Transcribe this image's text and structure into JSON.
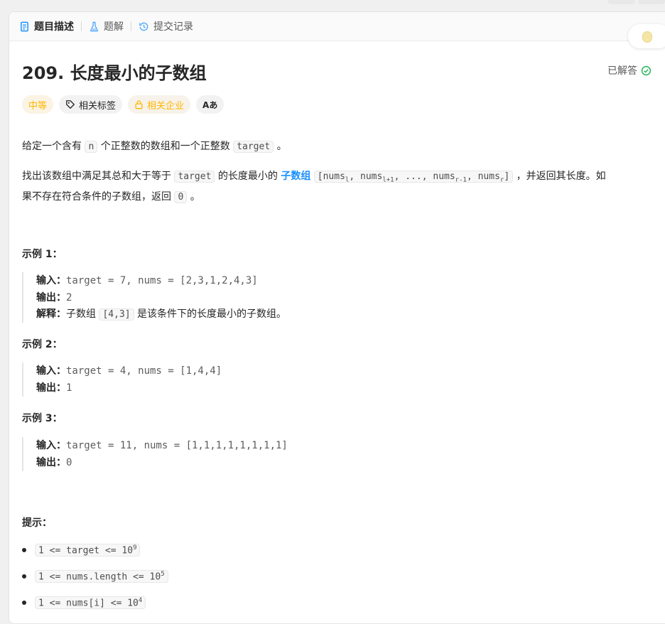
{
  "tabs": [
    {
      "label": "题目描述",
      "icon": "document-icon"
    },
    {
      "label": "题解",
      "icon": "flask-icon"
    },
    {
      "label": "提交记录",
      "icon": "history-icon"
    }
  ],
  "problem": {
    "title": "209. 长度最小的子数组",
    "status": "已解答",
    "tags": {
      "difficulty": "中等",
      "related_tags": "相关标签",
      "companies": "相关企业",
      "translate": "Aあ"
    }
  },
  "description": {
    "p1": {
      "a": "给定一个含有 ",
      "code1": "n",
      "b": " 个正整数的数组和一个正整数 ",
      "code2": "target",
      "c": " 。"
    },
    "p2": {
      "a": "找出该数组中满足其总和大于等于 ",
      "code1": "target",
      "b": " 的长度最小的 ",
      "link": "子数组",
      "c": " ，并返回其长度。如",
      "line2": "果不存在符合条件的子数组，返回 ",
      "code3": "0",
      "d": " 。"
    }
  },
  "examples": [
    {
      "heading": "示例 1：",
      "input_label": "输入：",
      "input": "target = 7, nums = [2,3,1,2,4,3]",
      "output_label": "输出：",
      "output": "2",
      "explain_label": "解释：",
      "explain_a": "子数组 ",
      "explain_code": "[4,3]",
      "explain_b": " 是该条件下的长度最小的子数组。"
    },
    {
      "heading": "示例 2：",
      "input_label": "输入：",
      "input": "target = 4, nums = [1,4,4]",
      "output_label": "输出：",
      "output": "1"
    },
    {
      "heading": "示例 3：",
      "input_label": "输入：",
      "input": "target = 11, nums = [1,1,1,1,1,1,1,1]",
      "output_label": "输出：",
      "output": "0"
    }
  ],
  "constraints": {
    "heading": "提示：",
    "items": [
      {
        "text": "1 <= target <= 10",
        "sup": "9"
      },
      {
        "text": "1 <= nums.length <= 10",
        "sup": "5"
      },
      {
        "text": "1 <= nums[i] <= 10",
        "sup": "4"
      }
    ]
  }
}
